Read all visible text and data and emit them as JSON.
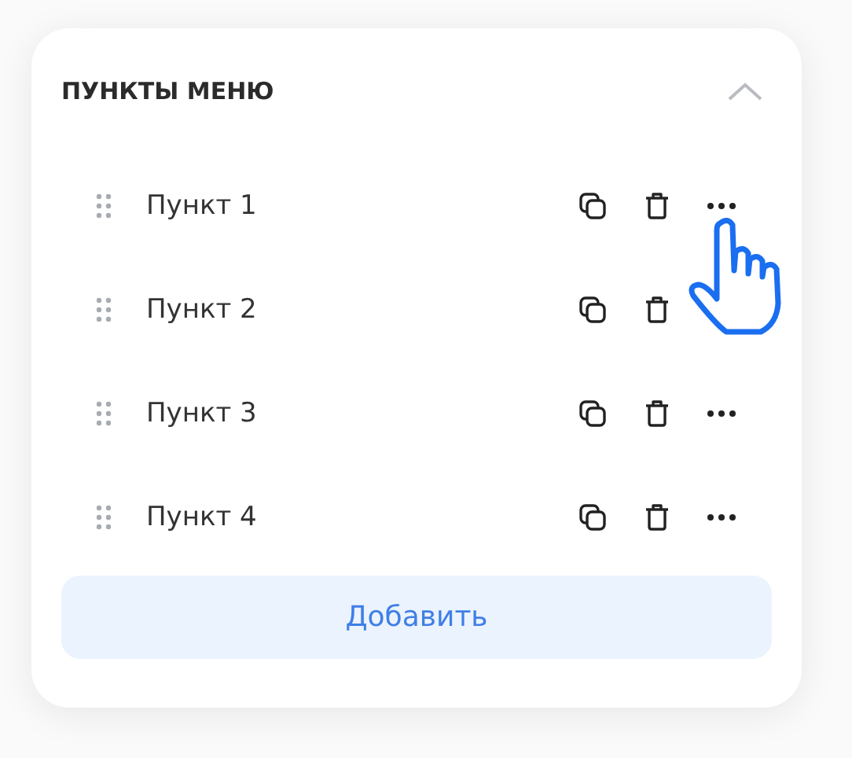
{
  "section": {
    "title": "ПУНКТЫ МЕНЮ",
    "expanded": true
  },
  "items": [
    {
      "label": "Пункт 1",
      "more_button": true,
      "cursor": true
    },
    {
      "label": "Пункт 2",
      "more_button": false,
      "cursor": false
    },
    {
      "label": "Пункт 3",
      "more_button": true,
      "cursor": false
    },
    {
      "label": "Пункт 4",
      "more_button": true,
      "cursor": false
    }
  ],
  "add_button": "Добавить"
}
